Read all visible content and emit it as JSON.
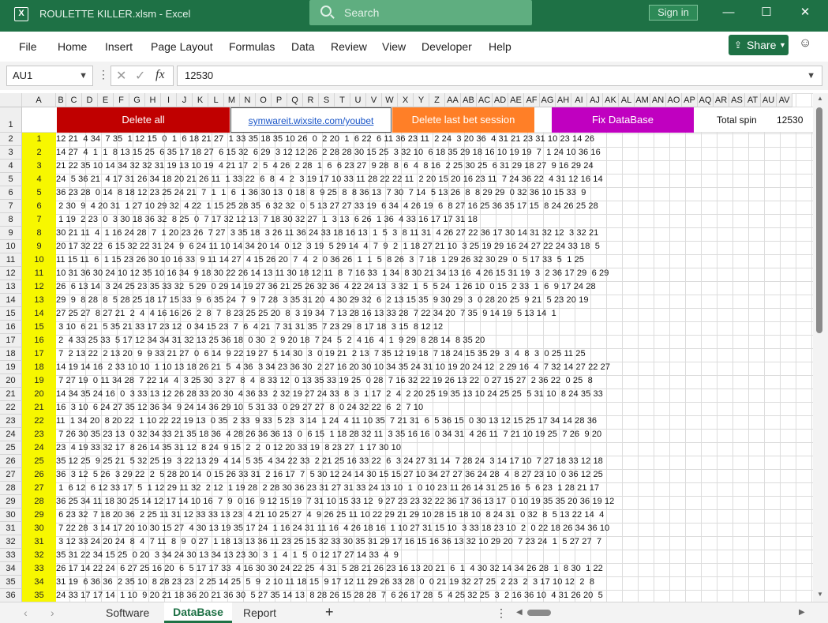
{
  "window": {
    "title": "ROULETTE KILLER.xlsm  -  Excel",
    "search_placeholder": "Search",
    "signin_label": "Sign in",
    "minimize": "—",
    "maximize": "☐",
    "close": "✕",
    "app_icon": "excel-icon"
  },
  "menu": {
    "items": [
      "File",
      "Home",
      "Insert",
      "Page Layout",
      "Formulas",
      "Data",
      "Review",
      "View",
      "Developer",
      "Help"
    ],
    "share_label": "Share"
  },
  "formula_bar": {
    "name_box": "AU1",
    "formula_value": "12530",
    "fx": "fx"
  },
  "columns": [
    "A",
    "B",
    "C",
    "D",
    "E",
    "F",
    "G",
    "H",
    "I",
    "J",
    "K",
    "L",
    "M",
    "N",
    "O",
    "P",
    "Q",
    "R",
    "S",
    "T",
    "U",
    "V",
    "W",
    "X",
    "Y",
    "Z",
    "AA",
    "AB",
    "AC",
    "AD",
    "AE",
    "AF",
    "AG",
    "AH",
    "AI",
    "AJ",
    "AK",
    "AL",
    "AM",
    "AN",
    "AO",
    "AP",
    "AQ",
    "AR",
    "AS",
    "AT",
    "AU",
    "AV"
  ],
  "row_header_labels": [
    "1",
    "2",
    "3",
    "4",
    "5",
    "6",
    "7",
    "8",
    "9",
    "10",
    "11",
    "12",
    "13",
    "14",
    "15",
    "16",
    "17",
    "18",
    "19",
    "20",
    "21",
    "22",
    "23",
    "24",
    "25",
    "26",
    "27",
    "28",
    "29",
    "30",
    "31",
    "32",
    "33",
    "34",
    "35",
    "36"
  ],
  "row1": {
    "delete_all": "Delete all",
    "link": "symwareit.wixsite.com/youbet",
    "delete_last": "Delete last bet session",
    "fix_db": "Fix DataBase",
    "total_spin_label": "Total spin",
    "total_spin_value": "12530",
    "delete_all_color": "#c00000",
    "delete_last_color": "#ff7f27",
    "fix_db_color": "#c000c0"
  },
  "sequence_numbers": [
    "1",
    "2",
    "3",
    "4",
    "5",
    "6",
    "7",
    "8",
    "9",
    "10",
    "11",
    "12",
    "13",
    "14",
    "15",
    "16",
    "17",
    "18",
    "19",
    "20",
    "21",
    "22",
    "23",
    "24",
    "25",
    "26",
    "27",
    "28",
    "29",
    "30",
    "31",
    "32",
    "33",
    "34",
    "35"
  ],
  "rows": [
    "12 21  4 34  7 35  1 12 15  0  1  6 18 21 27  1 33 35 18 35 10 26  0  2 20  1  6 22  6 11 36 23 11  2 24  3 20 36  4 31 21 23 31 10 23 14 26",
    "14 27  4  1  1  8 13 15 25  6 35 17 18 27  6 15 32  6 29  3 12 12 26  2 28 28 30 15 25  3 32 10  6 18 35 29 18 16 10 19 19  7  1 24 10 36 16",
    "21 22 35 10 14 34 32 32 31 19 13 10 19  4 21 17  2  5  4 26  2 28  1  6  6 23 27  9 28  8  6  4  8 16  2 25 30 25  6 31 29 18 27  9 16 29 24",
    "24  5 36 21  4 17 31 26 34 18 20 21 26 11  1 33 22  6  8  4  2  3 19 17 10 33 11 28 22 22 11  2 20 15 20 16 23 11  7 24 36 22  4 31 12 16 14",
    "36 23 28  0 14  8 18 12 23 25 24 21  7  1  1  6  1 36 30 13  0 18  8  9 25  8  8 36 13  7 30  7 14  5 13 26  8  8 29 29  0 32 36 10 15 33  9",
    " 2 30  9  4 20 31  1 27 10 29 32  4 22  1 15 25 28 35  6 32 32  0  5 13 27 27 33 19  6 34  4 26 19  6  8 27 16 25 36 35 17 15  8 24 26 25 28",
    " 1 19  2 23  0  3 30 18 36 32  8 25  0  7 17 32 12 13  7 18 30 32 27  1  3 13  6 26  1 36  4 33 16 17 17 31 18",
    "30 21 11  4  1 16 24 28  7  1 20 23 26  7 27  3 35 18  3 26 11 36 24 33 18 16 13  1  5  3  8 11 31  4 26 27 22 36 17 30 14 31 32 12  3 32 21",
    "20 17 32 22  6 15 32 22 31 24  9  6 24 11 10 14 34 20 14  0 12  3 19  5 29 14  4  7  9  2  1 18 27 21 10  3 25 19 29 16 24 27 22 24 33 18  5",
    "11 15 11  6  1 15 23 26 30 10 16 33  9 11 14 27  4 15 26 20  7  4  2  0 36 26  1  1  5  8 26  3  7 18  1 29 26 32 30 29  0  5 17 33  5  1 25",
    "10 31 36 30 24 10 12 35 10 16 34  9 18 30 22 26 14 13 11 30 18 12 11  8  7 16 33  1 34  8 30 21 34 13 16  4 26 15 31 19  3  2 36 17 29  6 29",
    "26  6 13 14  3 24 25 23 35 33 32  5 29  0 29 14 19 27 36 21 25 26 32 36  4 22 24 13  3 32  1  5  5 24  1 26 10  0 15  2 33  1  6  9 17 24 28",
    "29  9  8 28  8  5 28 25 18 17 15 33  9  6 35 24  7  9  7 28  3 35 31 20  4 30 29 32  6  2 13 15 35  9 30 29  3  0 28 20 25  9 21  5 23 20 19",
    "27 25 27  8 27 21  2  4  4 16 16 26  2  8  7  8 23 25 25 20  8  3 19 34  7 13 28 16 13 33 28  7 22 34 20  7 35  9 14 19  5 13 14  1",
    " 3 10  6 21  5 35 21 33 17 23 12  0 34 15 23  7  6  4 21  7 31 31 35  7 23 29  8 17 18  3 15  8 12 12",
    " 2  4 33 25 33  5 17 12 34 34 31 32 13 25 36 18  0 30  2  9 20 18  7 24  5  2  4 16  4  1  9 29  8 28 14  8 35 20",
    " 7  2 13 22  2 13 20  9  9 33 21 27  0  6 14  9 22 19 27  5 14 30  3  0 19 21  2 13  7 35 12 19 18  7 18 24 15 35 29  3  4  8  3  0 25 11 25",
    "14 19 14 16  2 33 10 10  1 10 13 18 26 21  5  4 36  3 34 23 36 30  2 27 16 20 30 10 34 35 24 31 10 19 20 24 12  2 29 16  4  7 32 14 27 22 27",
    " 7 27 19  0 11 34 28  7 22 14  4  3 25 30  3 27  8  4  8 33 12  0 13 35 33 19 25  0 28  7 16 32 22 19 26 13 22  0 27 15 27  2 36 22  0 25  8",
    "14 34 35 24 16  0  3 33 13 12 26 28 33 20 30  4 36 33  2 32 19 27 24 33  8  3  1 17  2  4  2 20 25 19 35 13 10 24 25 25  5 31 10  8 24 35 33",
    "16  3 10  6 24 27 35 12 36 34  9 24 14 36 29 10  5 31 33  0 29 27 27  8  0 24 32 22  6  2  7 10",
    "11  1 34 20  8 20 22  1 10 22 22 19 13  0 35  2 33  9 33  5 23  3 14  1 24  4 11 10 35  7 21 31  6  5 36 15  0 30 13 12 15 25 17 34 14 28 36",
    " 7 26 30 35 23 13  0 32 34 33 21 35 18 36  4 28 26 36 36 13  0  6 15  1 18 28 32 11  3 35 16 16  0 34 31  4 26 11  7 21 10 19 25  7 26  9 20",
    "23  4 19 33 32 17  8 26 14 35 31 12  8 24  9 15  2  2  0 12 20 33 19  8 23 27  1 17 30 10",
    "35 12 25  9 25 21  5 32 25 19  3 22 13 29  4 14  5 35  4 34 22 33  2 21 25 16 33 22  6  3 24 27 31 14  7 28 24  3 14 17 10  7 27 18 33 12 18",
    "36  3 12  5 26  3 29 22  2  5 28 20 14  0 15 26 33 31  2 16 17  7  5 30 12 24 14 30 15 15 27 10 34 27 27 36 24 28  4  8 27 23 10  0 36 12 25",
    " 1  6 12  6 12 33 17  5  1 12 29 11 32  2 12  1 19 28  2 28 30 36 23 31 27 31 33 24 13 10  1  0 10 23 11 26 14 31 25 16  5  6 23  1 28 21 17",
    "36 25 34 11 18 30 25 14 12 17 14 10 16  7  9  0 16  9 12 15 19  7 31 10 15 33 12  9 27 23 23 32 22 36 17 36 13 17  0 10 19 35 35 20 36 19 12",
    " 6 23 32  7 18 20 36  2 25 11 31 12 33 33 13 23  4 21 10 25 27  4  9 26 25 11 10 22 29 21 29 10 28 15 18 10  8 24 31  0 32  8  5 13 22 14  4",
    " 7 22 28  3 14 17 20 10 30 15 27  4 30 13 19 35 17 24  1 16 24 31 11 16  4 26 18 16  1 10 27 31 15 10  3 33 18 23 10  2  0 22 18 26 34 36 10",
    " 3 12 33 24 20 24  8  4  7 11  8  9  0 27  1 18 13 13 36 11 23 25 15 32 33 30 35 31 29 17 16 15 16 36 13 32 10 29 20  7 23 24  1  5 27 27  7",
    "35 31 22 34 15 25  0 20  3 34 24 30 13 34 13 23 30  3  1  4  1  5  0 12 17 27 14 33  4  9",
    "26 17 14 22 24  6 27 25 16 20  6  5 17 17 33  4 16 30 30 24 22 25  4 31  5 28 21 26 23 16 13 20 21  6  1  4 30 32 14 34 26 28  1  8 30  1 22",
    "31 19  6 36 36  2 35 10  8 28 23 23  2 25 14 25  5  9  2 10 11 18 15  9 17 12 11 29 26 33 28  0  0 21 19 32 27 25  2 23  2  3 17 10 12  2  8",
    "24 33 17 17 14  1 10  9 20 21 18 36 20 21 36 30  5 27 35 14 13  8 28 26 15 28 28  7  6 26 17 28  5  4 25 32 25  3  2 16 36 10  4 31 26 20  5"
  ],
  "tabs": {
    "software": "Software",
    "database": "DataBase",
    "report": "Report",
    "add": "+"
  }
}
